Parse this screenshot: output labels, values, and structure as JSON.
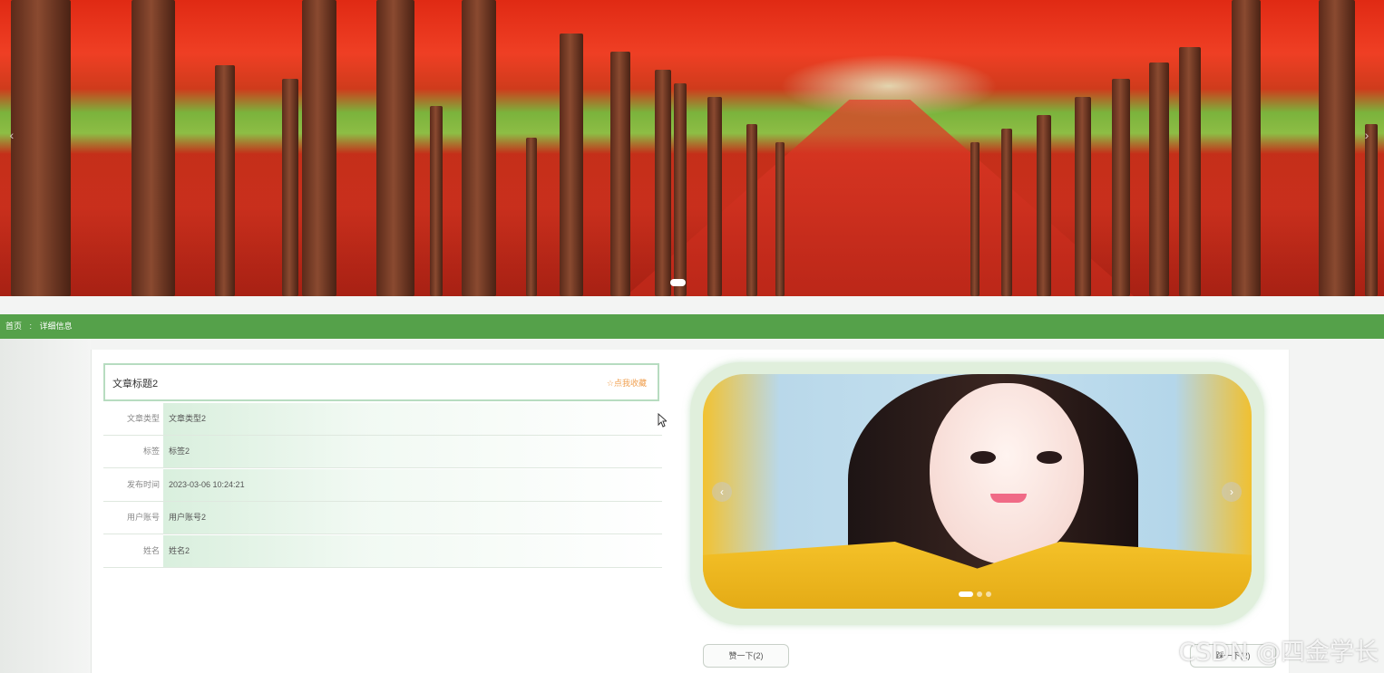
{
  "banner": {
    "prev": "‹",
    "next": "›"
  },
  "breadcrumb": {
    "home": "首页",
    "sep": ":",
    "current": "详细信息"
  },
  "detail": {
    "title": "文章标题2",
    "favorite_label": "☆点我收藏",
    "fields": [
      {
        "label": "文章类型",
        "value": "文章类型2"
      },
      {
        "label": "标签",
        "value": "标签2"
      },
      {
        "label": "发布时间",
        "value": "2023-03-06 10:24:21"
      },
      {
        "label": "用户账号",
        "value": "用户账号2"
      },
      {
        "label": "姓名",
        "value": "姓名2"
      }
    ]
  },
  "carousel": {
    "prev": "‹",
    "next": "›",
    "slides": 3,
    "active_slide": 1
  },
  "pager": {
    "like_label": "赞一下(2)",
    "dislike_label": "踩一下(2)"
  },
  "watermark": "CSDN @四金学长",
  "colors": {
    "accent_green": "#55a14a",
    "favorite_orange": "#f0a050"
  }
}
